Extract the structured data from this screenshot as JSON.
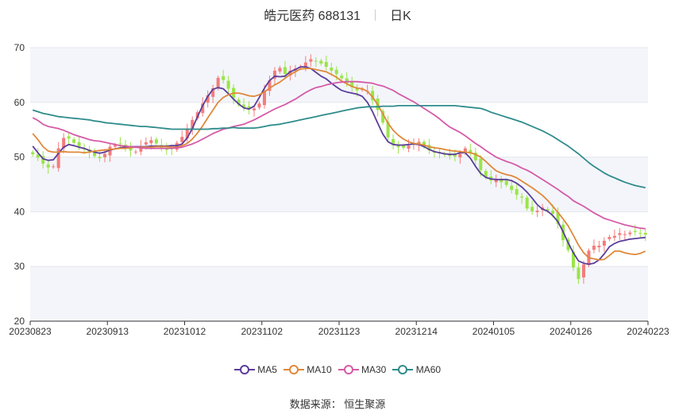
{
  "title": {
    "name": "皓元医药 688131",
    "period": "日K"
  },
  "source": "数据来源： 恒生聚源",
  "colors": {
    "up": "#f47c7c",
    "down": "#9be44a",
    "MA5": "#5b3d9a",
    "MA10": "#e0883a",
    "MA30": "#d55aa8",
    "MA60": "#2e8b8b",
    "grid": "#e3e6ee",
    "band": "#f3f5fa",
    "axis": "#333333"
  },
  "chart_data": {
    "type": "candlestick",
    "y_ticks": [
      20,
      30,
      40,
      50,
      60,
      70
    ],
    "ylim": [
      20,
      70
    ],
    "x_tick_labels": [
      "20230823",
      "20230913",
      "20231012",
      "20231102",
      "20231123",
      "20231214",
      "20240105",
      "20240126",
      "20240223"
    ],
    "legend": [
      "MA5",
      "MA10",
      "MA30",
      "MA60"
    ],
    "legend_position": "bottom",
    "n_bars": 120,
    "candles_close": [
      50.5,
      49.9,
      48.8,
      48.1,
      48.3,
      51.6,
      53.5,
      53.4,
      52.6,
      51.9,
      51.4,
      50.9,
      50.2,
      49.8,
      50.6,
      51.9,
      52.2,
      52.4,
      51.9,
      51.2,
      51.0,
      52.0,
      52.7,
      53.1,
      52.5,
      51.7,
      51.3,
      51.5,
      52.6,
      53.7,
      55.2,
      56.8,
      58.2,
      59.8,
      61.3,
      62.6,
      64.5,
      64.1,
      62.5,
      60.8,
      59.6,
      59.0,
      58.7,
      58.9,
      59.8,
      62.1,
      64.0,
      65.8,
      66.3,
      65.2,
      65.8,
      66.2,
      66.5,
      67.3,
      67.9,
      67.6,
      67.1,
      66.5,
      65.8,
      65.2,
      64.4,
      63.5,
      62.8,
      62.2,
      62.4,
      62.1,
      60.4,
      58.6,
      56.3,
      53.6,
      52.3,
      51.8,
      51.7,
      52.1,
      52.5,
      52.8,
      51.9,
      51.2,
      50.8,
      50.9,
      50.4,
      50.2,
      50.1,
      50.6,
      51.6,
      50.8,
      49.4,
      47.6,
      46.3,
      45.7,
      45.9,
      45.4,
      44.9,
      44.0,
      43.1,
      42.6,
      40.6,
      40.1,
      40.2,
      40.8,
      40.2,
      39.6,
      37.8,
      34.8,
      33.0,
      29.8,
      27.7,
      30.4,
      32.9,
      33.8,
      33.8,
      34.7,
      35.4,
      35.6,
      36.1,
      35.9,
      36.2,
      36.3,
      36.0,
      35.8
    ],
    "series": [
      {
        "name": "MA5",
        "values": [
          52.0,
          50.8,
          49.7,
          49.4,
          49.5,
          50.7,
          51.8,
          52.3,
          52.1,
          51.8,
          51.6,
          51.2,
          50.9,
          50.7,
          50.9,
          51.3,
          51.5,
          51.7,
          51.8,
          51.9,
          51.9,
          51.9,
          51.9,
          52.0,
          52.0,
          52.0,
          52.0,
          52.1,
          52.1,
          52.4,
          53.5,
          55.2,
          57.4,
          59.4,
          61.1,
          62.4,
          62.7,
          62.5,
          61.6,
          60.6,
          59.7,
          59.0,
          58.8,
          59.3,
          60.9,
          62.6,
          64.0,
          64.8,
          64.7,
          64.8,
          65.6,
          66.0,
          66.5,
          66.5,
          66.2,
          65.5,
          64.8,
          64.3,
          63.5,
          62.8,
          62.2,
          61.9,
          61.7,
          61.5,
          61.1,
          60.0,
          58.3,
          56.2,
          54.2,
          52.8,
          52.3,
          52.2,
          52.2,
          52.3,
          52.4,
          52.3,
          51.9,
          51.4,
          51.0,
          50.8,
          50.6,
          50.5,
          50.5,
          50.8,
          50.8,
          49.8,
          48.3,
          47.0,
          46.3,
          46.0,
          45.9,
          45.9,
          45.9,
          45.7,
          45.2,
          44.5,
          43.6,
          42.5,
          41.3,
          40.5,
          40.1,
          39.3,
          38.2,
          36.4,
          34.3,
          32.5,
          31.0,
          30.6,
          30.4,
          30.6,
          31.2,
          32.3,
          33.6,
          34.2,
          34.6,
          34.8,
          35.0,
          35.1,
          35.2,
          35.3
        ]
      },
      {
        "name": "MA10",
        "values": [
          54.3,
          53.2,
          51.9,
          51.1,
          50.9,
          50.9,
          51.0,
          50.9,
          50.9,
          50.9,
          50.8,
          50.9,
          51.1,
          51.2,
          51.3,
          51.4,
          51.5,
          51.6,
          51.6,
          51.7,
          51.8,
          51.8,
          51.8,
          51.8,
          51.9,
          51.9,
          51.9,
          51.8,
          51.8,
          52.1,
          52.5,
          53.3,
          54.4,
          55.7,
          57.2,
          58.6,
          60.0,
          60.9,
          61.4,
          61.7,
          61.7,
          61.5,
          61.2,
          61.1,
          61.4,
          61.9,
          62.6,
          63.2,
          63.7,
          64.4,
          65.1,
          65.6,
          66.1,
          66.2,
          66.2,
          66.0,
          65.8,
          65.6,
          65.1,
          64.6,
          63.9,
          63.4,
          62.9,
          62.6,
          62.5,
          62.0,
          61.0,
          59.6,
          57.9,
          56.2,
          54.9,
          54.0,
          53.3,
          52.8,
          52.5,
          52.4,
          52.2,
          51.9,
          51.7,
          51.6,
          51.4,
          51.2,
          51.1,
          51.0,
          50.9,
          50.8,
          50.5,
          50.0,
          49.2,
          48.3,
          47.5,
          47.1,
          46.8,
          46.6,
          46.2,
          45.6,
          45.0,
          44.4,
          43.7,
          43.0,
          42.1,
          41.0,
          39.9,
          38.7,
          37.4,
          35.7,
          33.9,
          32.5,
          31.6,
          31.4,
          31.2,
          31.3,
          32.0,
          32.8,
          32.8,
          32.5,
          32.3,
          32.2,
          32.4,
          32.8
        ]
      },
      {
        "name": "MA30",
        "values": [
          57.2,
          56.7,
          56.0,
          55.6,
          55.4,
          55.2,
          54.9,
          54.5,
          54.1,
          53.8,
          53.5,
          53.2,
          53.0,
          52.9,
          52.7,
          52.5,
          52.3,
          52.1,
          52.0,
          51.9,
          51.8,
          51.7,
          51.6,
          51.6,
          51.6,
          51.6,
          51.6,
          51.6,
          51.7,
          51.8,
          52.1,
          52.4,
          52.8,
          53.3,
          53.8,
          54.3,
          54.7,
          55.1,
          55.3,
          55.6,
          55.8,
          56.0,
          56.4,
          56.8,
          57.3,
          57.8,
          58.3,
          58.8,
          59.2,
          59.6,
          60.1,
          60.6,
          61.2,
          61.8,
          62.3,
          62.7,
          62.9,
          63.2,
          63.4,
          63.6,
          63.7,
          63.8,
          63.8,
          63.8,
          63.7,
          63.6,
          63.5,
          63.2,
          63.0,
          62.6,
          62.2,
          61.6,
          61.1,
          60.6,
          60.1,
          59.5,
          58.9,
          58.3,
          57.7,
          57.0,
          56.2,
          55.5,
          55.0,
          54.5,
          53.9,
          53.2,
          52.5,
          51.9,
          51.2,
          50.6,
          50.0,
          49.6,
          49.2,
          48.9,
          48.5,
          48.0,
          47.6,
          47.1,
          46.5,
          45.9,
          45.3,
          44.7,
          44.1,
          43.4,
          42.8,
          42.0,
          41.5,
          41.0,
          40.4,
          39.8,
          39.3,
          38.8,
          38.5,
          38.2,
          37.9,
          37.6,
          37.4,
          37.2,
          37.0,
          36.9
        ]
      },
      {
        "name": "MA60",
        "values": [
          58.6,
          58.3,
          58.0,
          57.8,
          57.6,
          57.4,
          57.3,
          57.2,
          57.1,
          57.0,
          56.9,
          56.8,
          56.6,
          56.5,
          56.3,
          56.2,
          56.1,
          56.0,
          55.9,
          55.8,
          55.7,
          55.6,
          55.6,
          55.5,
          55.4,
          55.3,
          55.2,
          55.1,
          55.1,
          55.1,
          55.1,
          55.1,
          55.1,
          55.1,
          55.1,
          55.2,
          55.2,
          55.3,
          55.3,
          55.4,
          55.3,
          55.3,
          55.3,
          55.3,
          55.4,
          55.6,
          55.8,
          55.9,
          56.0,
          56.2,
          56.4,
          56.6,
          56.8,
          57.0,
          57.2,
          57.4,
          57.6,
          57.8,
          58.0,
          58.2,
          58.4,
          58.6,
          58.8,
          59.0,
          59.1,
          59.2,
          59.2,
          59.2,
          59.3,
          59.3,
          59.3,
          59.4,
          59.4,
          59.4,
          59.4,
          59.4,
          59.4,
          59.4,
          59.4,
          59.4,
          59.4,
          59.4,
          59.4,
          59.3,
          59.2,
          59.1,
          59.0,
          58.9,
          58.6,
          58.2,
          57.9,
          57.6,
          57.3,
          57.0,
          56.7,
          56.4,
          56.0,
          55.6,
          55.2,
          54.8,
          54.3,
          53.8,
          53.2,
          52.6,
          52.0,
          51.3,
          50.6,
          49.8,
          49.0,
          48.3,
          47.7,
          47.1,
          46.6,
          46.2,
          45.8,
          45.4,
          45.1,
          44.8,
          44.6,
          44.4
        ]
      }
    ]
  }
}
